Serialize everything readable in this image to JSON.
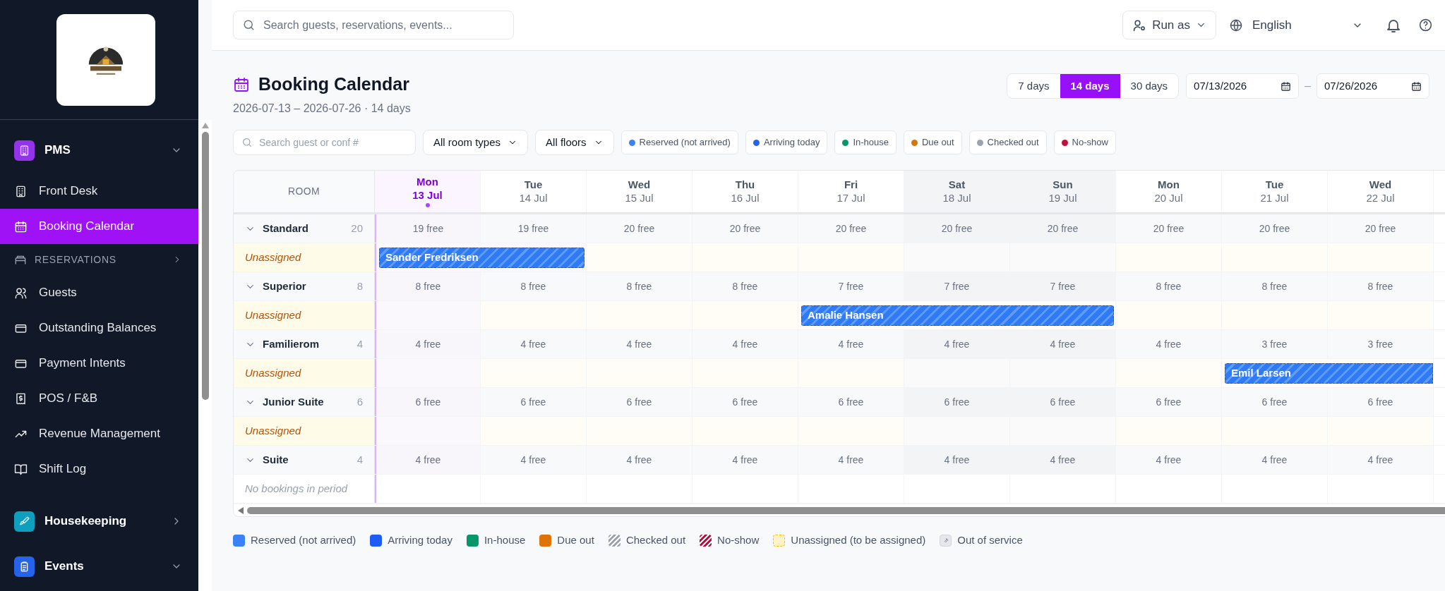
{
  "sidebar": {
    "sections": [
      {
        "label": "PMS",
        "color": "#9333ea",
        "expanded": true,
        "items": [
          {
            "kind": "link",
            "label": "Front Desk",
            "selected": false
          },
          {
            "kind": "link",
            "label": "Booking Calendar",
            "selected": true
          },
          {
            "kind": "group",
            "label": "RESERVATIONS",
            "selected": false
          },
          {
            "kind": "link",
            "label": "Guests",
            "selected": false
          },
          {
            "kind": "link",
            "label": "Outstanding Balances",
            "selected": false
          },
          {
            "kind": "link",
            "label": "Payment Intents",
            "selected": false
          },
          {
            "kind": "link",
            "label": "POS / F&B",
            "selected": false
          },
          {
            "kind": "link",
            "label": "Revenue Management",
            "selected": false
          },
          {
            "kind": "link",
            "label": "Shift Log",
            "selected": false
          }
        ]
      },
      {
        "label": "Housekeeping",
        "color": "#0e9fbf",
        "expanded": false
      },
      {
        "label": "Events",
        "color": "#2563eb",
        "expanded": true
      }
    ]
  },
  "topbar": {
    "search": {
      "placeholder": "Search guests, reservations, events..."
    },
    "run_as": "Run as",
    "language": "English"
  },
  "page": {
    "title": "Booking Calendar",
    "subtitle": "2026-07-13 – 2026-07-26 · 14 days",
    "ranges": [
      {
        "label": "7 days",
        "selected": false
      },
      {
        "label": "14 days",
        "selected": true
      },
      {
        "label": "30 days",
        "selected": false
      }
    ],
    "date_from": "07/13/2026",
    "range_separator": "–",
    "date_to": "07/26/2026"
  },
  "filters": {
    "search": {
      "placeholder": "Search guest or conf #"
    },
    "selects": [
      "All room types",
      "All floors"
    ],
    "chips": [
      {
        "label": "Reserved (not arrived)",
        "color": "#3b82f6"
      },
      {
        "label": "Arriving today",
        "color": "#2563eb"
      },
      {
        "label": "In-house",
        "color": "#059669"
      },
      {
        "label": "Due out",
        "color": "#d97706"
      },
      {
        "label": "Checked out",
        "color": "#9ca3af"
      },
      {
        "label": "No-show",
        "color": "#be123c"
      }
    ]
  },
  "calendar": {
    "room_header": "ROOM",
    "days": [
      {
        "weekday": "Mon",
        "date": "13 Jul",
        "today": true,
        "weekend": false
      },
      {
        "weekday": "Tue",
        "date": "14 Jul",
        "today": false,
        "weekend": false
      },
      {
        "weekday": "Wed",
        "date": "15 Jul",
        "today": false,
        "weekend": false
      },
      {
        "weekday": "Thu",
        "date": "16 Jul",
        "today": false,
        "weekend": false
      },
      {
        "weekday": "Fri",
        "date": "17 Jul",
        "today": false,
        "weekend": false
      },
      {
        "weekday": "Sat",
        "date": "18 Jul",
        "today": false,
        "weekend": true
      },
      {
        "weekday": "Sun",
        "date": "19 Jul",
        "today": false,
        "weekend": true
      },
      {
        "weekday": "Mon",
        "date": "20 Jul",
        "today": false,
        "weekend": false
      },
      {
        "weekday": "Tue",
        "date": "21 Jul",
        "today": false,
        "weekend": false
      },
      {
        "weekday": "Wed",
        "date": "22 Jul",
        "today": false,
        "weekend": false
      }
    ],
    "room_types": [
      {
        "name": "Standard",
        "count": "20",
        "expanded": true,
        "availability": [
          "19 free",
          "19 free",
          "20 free",
          "20 free",
          "20 free",
          "20 free",
          "20 free",
          "20 free",
          "20 free",
          "20 free"
        ],
        "sub_row": {
          "kind": "unassigned",
          "label": "Unassigned",
          "cells": [
            {
              "kind": "booking",
              "guest": "Sander Fredriksen"
            },
            {
              "kind": "stay"
            },
            {
              "kind": "empty"
            },
            {
              "kind": "empty"
            },
            {
              "kind": "empty"
            },
            {
              "kind": "empty"
            },
            {
              "kind": "empty"
            },
            {
              "kind": "empty"
            },
            {
              "kind": "empty"
            },
            {
              "kind": "empty"
            }
          ]
        }
      },
      {
        "name": "Superior",
        "count": "8",
        "expanded": true,
        "availability": [
          "8 free",
          "8 free",
          "8 free",
          "8 free",
          "7 free",
          "7 free",
          "7 free",
          "8 free",
          "8 free",
          "8 free"
        ],
        "sub_row": {
          "kind": "unassigned",
          "label": "Unassigned",
          "cells": [
            {
              "kind": "empty"
            },
            {
              "kind": "empty"
            },
            {
              "kind": "empty"
            },
            {
              "kind": "empty"
            },
            {
              "kind": "booking",
              "guest": "Amalie Hansen"
            },
            {
              "kind": "stay"
            },
            {
              "kind": "stay"
            },
            {
              "kind": "empty"
            },
            {
              "kind": "empty"
            },
            {
              "kind": "empty"
            }
          ]
        }
      },
      {
        "name": "Familierom",
        "count": "4",
        "expanded": true,
        "availability": [
          "4 free",
          "4 free",
          "4 free",
          "4 free",
          "4 free",
          "4 free",
          "4 free",
          "4 free",
          "3 free",
          "3 free"
        ],
        "sub_row": {
          "kind": "unassigned",
          "label": "Unassigned",
          "cells": [
            {
              "kind": "empty"
            },
            {
              "kind": "empty"
            },
            {
              "kind": "empty"
            },
            {
              "kind": "empty"
            },
            {
              "kind": "empty"
            },
            {
              "kind": "empty"
            },
            {
              "kind": "empty"
            },
            {
              "kind": "empty"
            },
            {
              "kind": "booking",
              "guest": "Emil Larsen"
            },
            {
              "kind": "stay"
            }
          ]
        }
      },
      {
        "name": "Junior Suite",
        "count": "6",
        "expanded": true,
        "availability": [
          "6 free",
          "6 free",
          "6 free",
          "6 free",
          "6 free",
          "6 free",
          "6 free",
          "6 free",
          "6 free",
          "6 free"
        ],
        "sub_row": {
          "kind": "unassigned",
          "label": "Unassigned"
        }
      },
      {
        "name": "Suite",
        "count": "4",
        "expanded": true,
        "availability": [
          "4 free",
          "4 free",
          "4 free",
          "4 free",
          "4 free",
          "4 free",
          "4 free",
          "4 free",
          "4 free",
          "4 free"
        ],
        "sub_row": {
          "kind": "empty",
          "label": "No bookings in period"
        }
      }
    ]
  },
  "legend": [
    {
      "kind": "solid",
      "label": "Reserved (not arrived)",
      "color": "#3b82f6"
    },
    {
      "kind": "solid",
      "label": "Arriving today",
      "color": "#1d5cf5"
    },
    {
      "kind": "solid",
      "label": "In-house",
      "color": "#059669"
    },
    {
      "kind": "solid",
      "label": "Due out",
      "color": "#e07306"
    },
    {
      "kind": "striped",
      "label": "Checked out",
      "color": "#9ca3af"
    },
    {
      "kind": "striped",
      "label": "No-show",
      "color": "#be123c"
    },
    {
      "kind": "dashed",
      "label": "Unassigned (to be assigned)",
      "color": "#fef3c7"
    },
    {
      "kind": "icon",
      "label": "Out of service",
      "color": "#e5e7eb"
    }
  ]
}
